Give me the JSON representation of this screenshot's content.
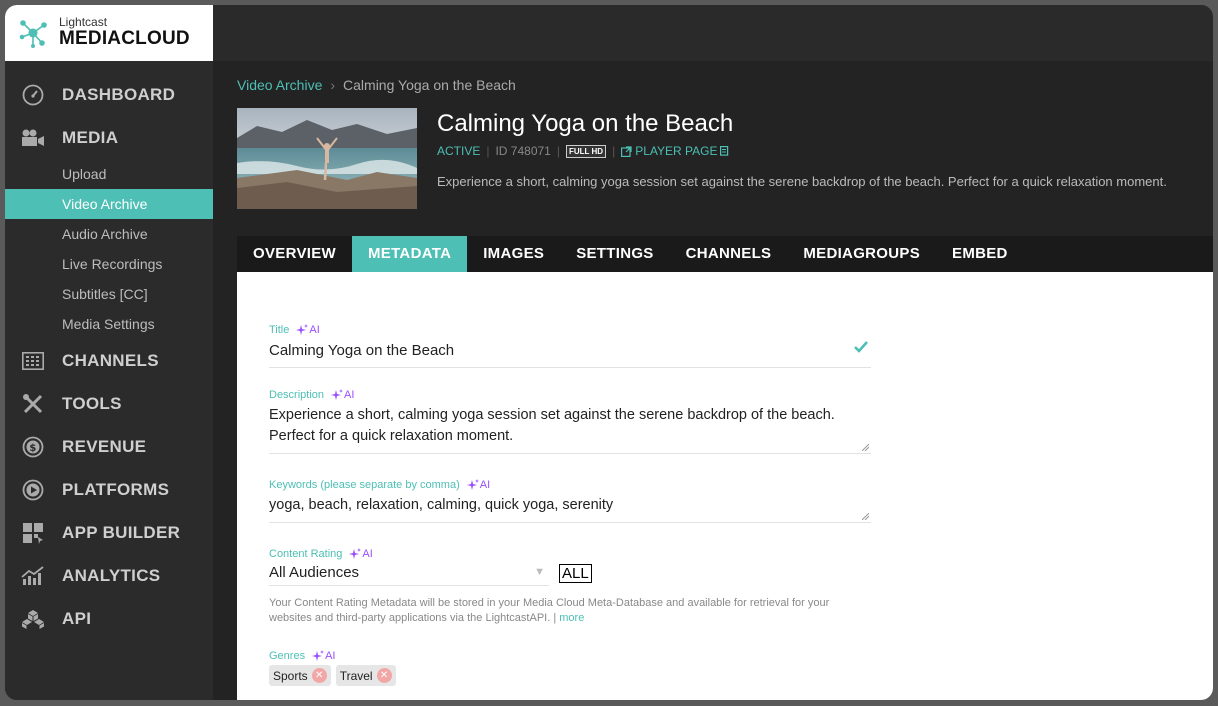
{
  "brand": {
    "top": "Lightcast",
    "main_bold": "MEDIA",
    "main_light": "CLOUD"
  },
  "nav": {
    "dashboard": "DASHBOARD",
    "media": "MEDIA",
    "media_sub": [
      "Upload",
      "Video Archive",
      "Audio Archive",
      "Live Recordings",
      "Subtitles [CC]",
      "Media Settings"
    ],
    "channels": "CHANNELS",
    "tools": "TOOLS",
    "revenue": "REVENUE",
    "platforms": "PLATFORMS",
    "app_builder": "APP BUILDER",
    "analytics": "ANALYTICS",
    "api": "API"
  },
  "breadcrumb": {
    "parent": "Video Archive",
    "current": "Calming Yoga on the Beach"
  },
  "video": {
    "title": "Calming Yoga on the Beach",
    "status": "ACTIVE",
    "id": "ID 748071",
    "quality": "FULL HD",
    "player_page": "PLAYER PAGE",
    "description": "Experience a short, calming yoga session set against the serene backdrop of the beach. Perfect for a quick relaxation moment."
  },
  "tabs": [
    "OVERVIEW",
    "METADATA",
    "IMAGES",
    "SETTINGS",
    "CHANNELS",
    "MEDIAGROUPS",
    "EMBED"
  ],
  "form": {
    "ai_tag": "AI",
    "title_label": "Title",
    "title_value": "Calming Yoga on the Beach",
    "description_label": "Description",
    "description_line1": "Experience a short, calming yoga session set against the serene backdrop of the beach.",
    "description_line2": "Perfect for a quick relaxation moment.",
    "keywords_label": "Keywords (please separate by comma)",
    "keywords_value": "yoga, beach, relaxation, calming, quick yoga, serenity",
    "rating_label": "Content Rating",
    "rating_value": "All Audiences",
    "rating_badge": "ALL",
    "rating_help": "Your Content Rating Metadata will be stored in your Media Cloud Meta-Database and available for retrieval for your websites and third-party applications via the LightcastAPI. |",
    "rating_more": "more",
    "genres_label": "Genres",
    "genres": [
      "Sports",
      "Travel"
    ]
  },
  "colors": {
    "accent": "#4dbfb4",
    "ai": "#9b4dff"
  }
}
